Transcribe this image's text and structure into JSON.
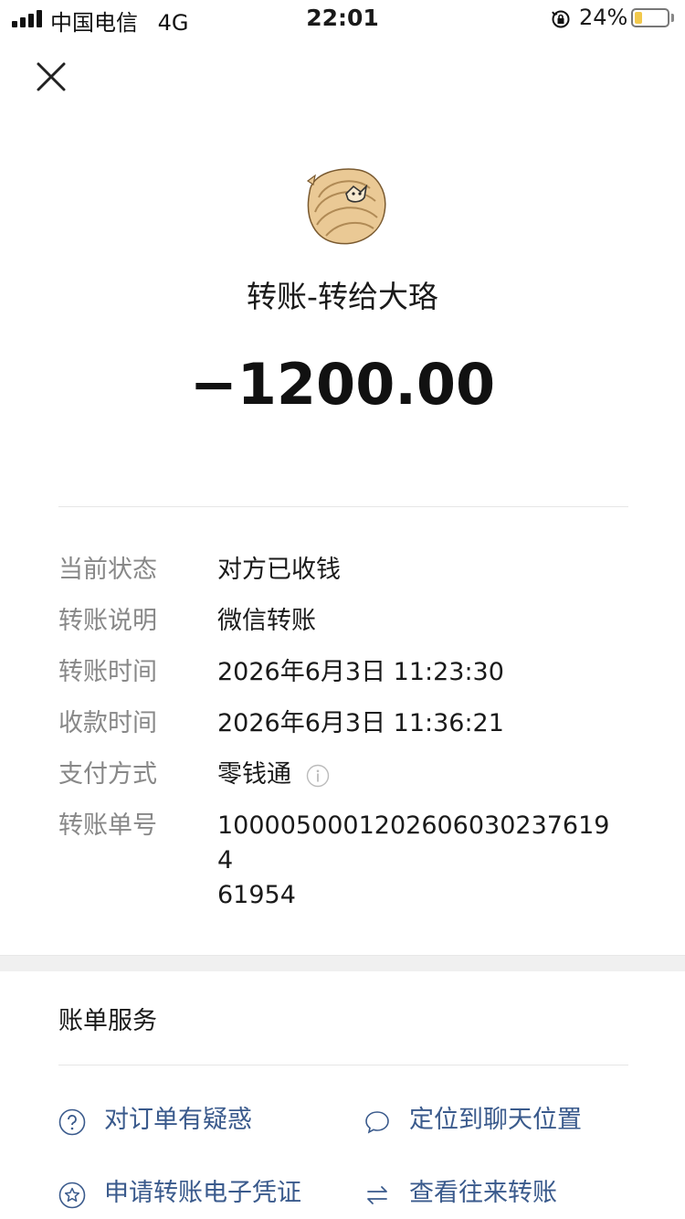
{
  "status_bar": {
    "carrier": "中国电信",
    "network": "4G",
    "time": "22:01",
    "battery": "24%",
    "battery_level": 0.24
  },
  "header": {
    "close_icon": "close-icon"
  },
  "transfer": {
    "title": "转账-转给大珞",
    "amount": "−1200.00"
  },
  "details": [
    {
      "label": "当前状态",
      "value": "对方已收钱"
    },
    {
      "label": "转账说明",
      "value": "微信转账"
    },
    {
      "label": "转账时间",
      "value": "2026年6月3日 11:23:30"
    },
    {
      "label": "收款时间",
      "value": "2026年6月3日 11:36:21"
    },
    {
      "label": "支付方式",
      "value": "零钱通"
    },
    {
      "label": "转账单号",
      "value": "100005000120260603023761946195 4"
    }
  ],
  "order_no": "10000500012026060302376194 61954",
  "services": {
    "title": "账单服务",
    "items": [
      {
        "label": "对订单有疑惑",
        "icon": "question-circle-icon"
      },
      {
        "label": "定位到聊天位置",
        "icon": "chat-bubble-icon"
      },
      {
        "label": "申请转账电子凭证",
        "icon": "star-badge-icon"
      },
      {
        "label": "查看往来转账",
        "icon": "exchange-arrows-icon"
      }
    ]
  },
  "colors": {
    "link": "#3a5a8c",
    "label": "#888888",
    "battery": "#f2c94c"
  }
}
